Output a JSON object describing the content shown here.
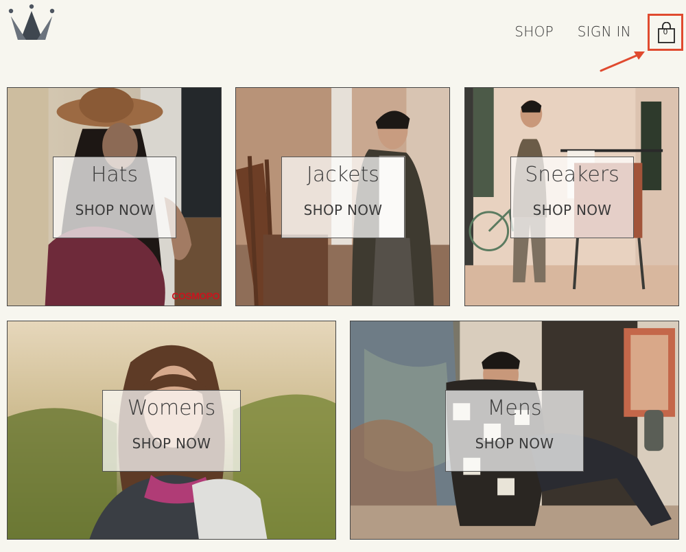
{
  "header": {
    "logo_icon": "crown-icon",
    "nav": {
      "shop_label": "SHOP",
      "signin_label": "SIGN IN"
    },
    "cart": {
      "icon": "shopping-bag-icon",
      "count": "0",
      "highlight_color": "#e04a2f"
    }
  },
  "categories": [
    {
      "title": "Hats",
      "cta": "SHOP NOW",
      "photo_text": "COSMOPO"
    },
    {
      "title": "Jackets",
      "cta": "SHOP NOW"
    },
    {
      "title": "Sneakers",
      "cta": "SHOP NOW"
    },
    {
      "title": "Womens",
      "cta": "SHOP NOW"
    },
    {
      "title": "Mens",
      "cta": "SHOP NOW"
    }
  ]
}
